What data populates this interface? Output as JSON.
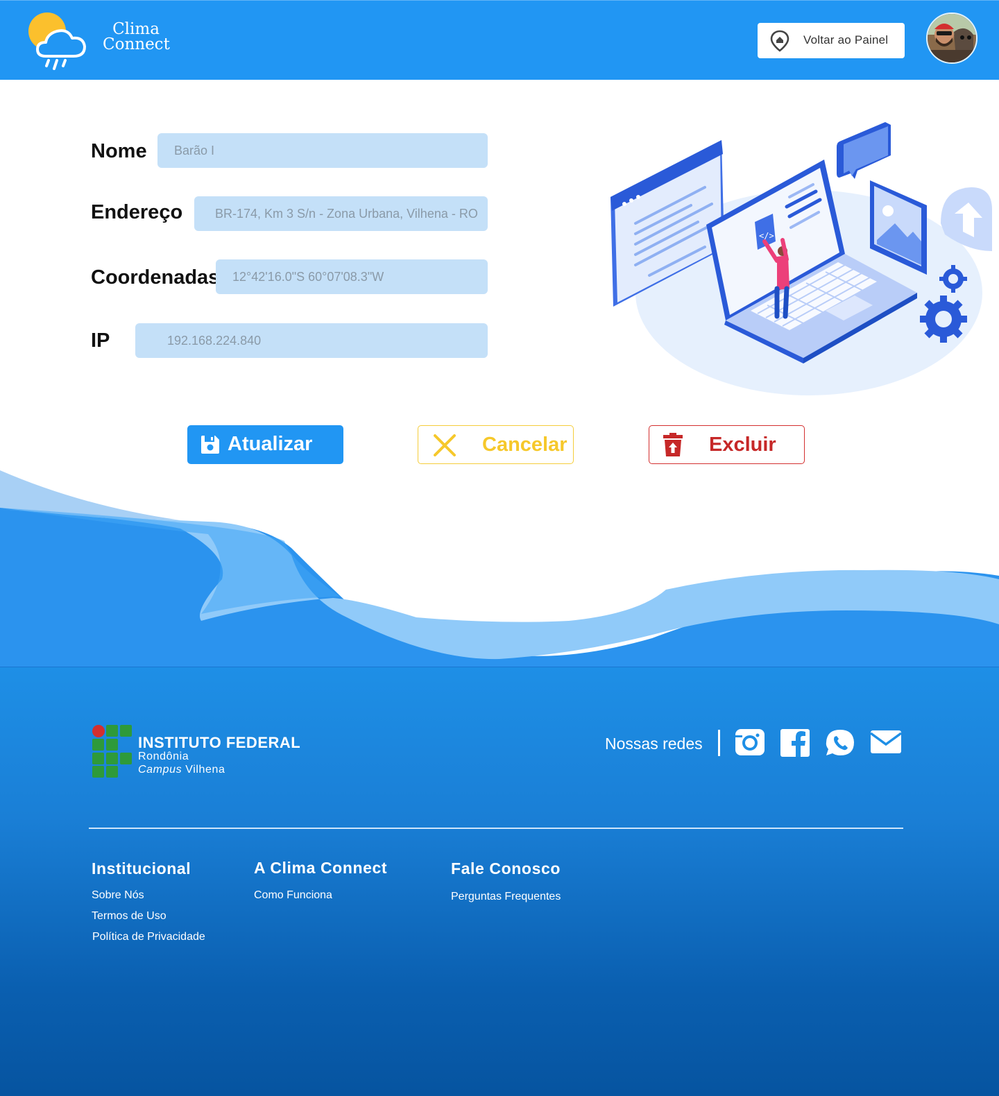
{
  "header": {
    "brand_line1": "Clima",
    "brand_line2": "Connect",
    "back_button_label": "Voltar ao Painel"
  },
  "form": {
    "fields": [
      {
        "label": "Nome",
        "value": "Barão I"
      },
      {
        "label": "Endereço",
        "value": "BR-174, Km 3 S/n - Zona Urbana, Vilhena - RO"
      },
      {
        "label": "Coordenadas",
        "value": "12°42'16.0\"S 60°07'08.3\"W"
      },
      {
        "label": "IP",
        "value": "192.168.224.840"
      }
    ]
  },
  "actions": {
    "update_label": "Atualizar",
    "cancel_label": "Cancelar",
    "delete_label": "Excluir"
  },
  "footer": {
    "institute_title": "INSTITUTO FEDERAL",
    "institute_state": "Rondônia",
    "institute_campus_italic": "Campus",
    "institute_campus_name": "Vilhena",
    "social_label": "Nossas redes",
    "social_icons": [
      "instagram-icon",
      "facebook-icon",
      "whatsapp-icon",
      "email-icon"
    ],
    "columns": [
      {
        "title": "Institucional",
        "links": [
          "Sobre Nós",
          "Termos de Uso",
          "Política de Privacidade"
        ]
      },
      {
        "title": "A Clima Connect",
        "links": [
          "Como Funciona"
        ]
      },
      {
        "title": "Fale Conosco",
        "links": [
          "Perguntas Frequentes"
        ]
      }
    ]
  },
  "colors": {
    "primary": "#2196f3",
    "input_bg": "#c4e0f8",
    "cancel": "#f6c82b",
    "delete": "#c62828"
  }
}
